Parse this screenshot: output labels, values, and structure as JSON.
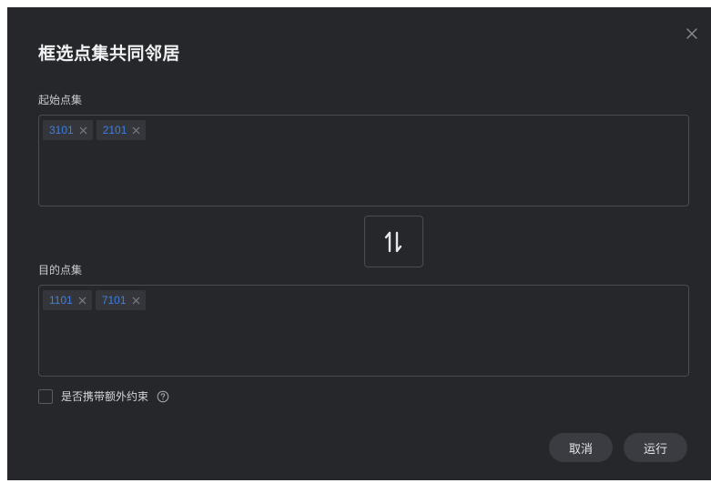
{
  "dialog": {
    "title": "框选点集共同邻居",
    "source_label": "起始点集",
    "source_tags": [
      "3101",
      "2101"
    ],
    "target_label": "目的点集",
    "target_tags": [
      "1101",
      "7101"
    ],
    "extra_constraint_label": "是否携带额外约束",
    "extra_constraint_checked": false,
    "cancel_label": "取消",
    "run_label": "运行"
  },
  "colors": {
    "dialog_bg": "#26272b",
    "tag_text": "#3d7fe0",
    "tag_bg": "#34363c",
    "button_bg": "#3a3c42"
  }
}
